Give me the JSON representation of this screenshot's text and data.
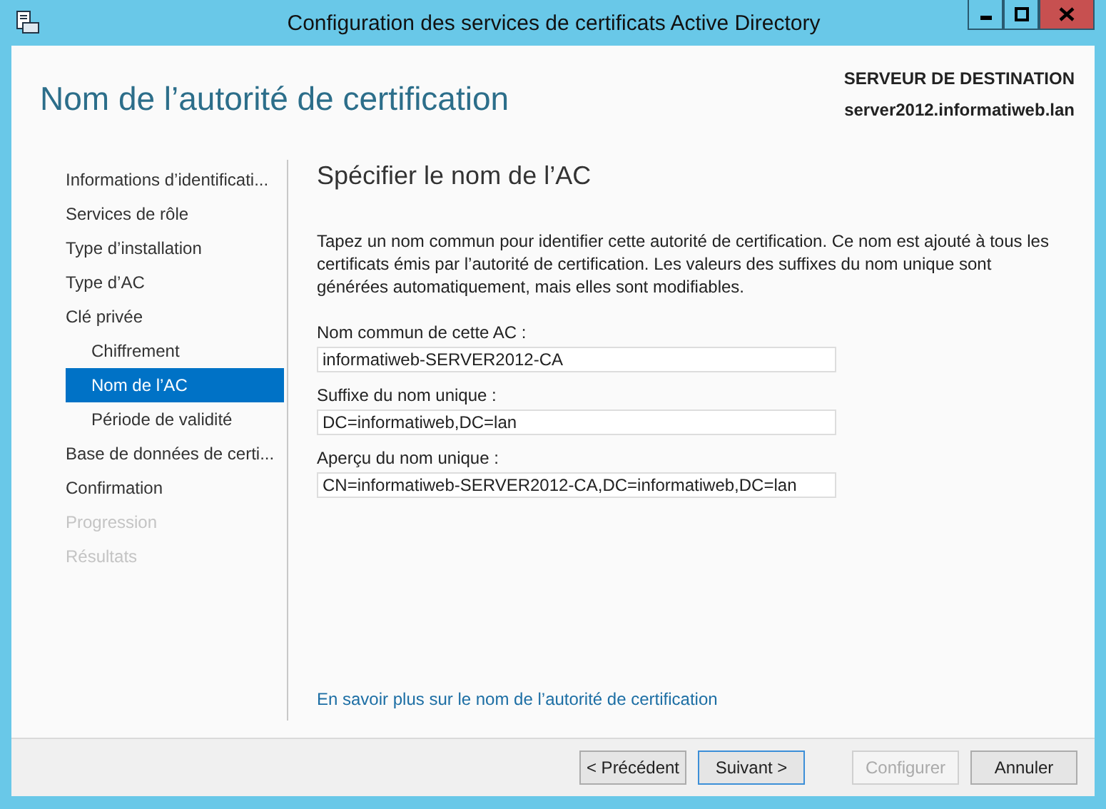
{
  "window": {
    "title": "Configuration des services de certificats Active Directory"
  },
  "header": {
    "title": "Nom de l’autorité de certification",
    "server_label": "SERVEUR DE DESTINATION",
    "server_name": "server2012.informatiweb.lan"
  },
  "sidebar": {
    "items": [
      {
        "label": "Informations d’identificati...",
        "selected": false,
        "disabled": false
      },
      {
        "label": "Services de rôle",
        "selected": false,
        "disabled": false
      },
      {
        "label": "Type d’installation",
        "selected": false,
        "disabled": false
      },
      {
        "label": "Type d’AC",
        "selected": false,
        "disabled": false
      },
      {
        "label": "Clé privée",
        "selected": false,
        "disabled": false,
        "children": [
          {
            "label": "Chiffrement",
            "selected": false,
            "disabled": false
          },
          {
            "label": "Nom de l’AC",
            "selected": true,
            "disabled": false
          },
          {
            "label": "Période de validité",
            "selected": false,
            "disabled": false
          }
        ]
      },
      {
        "label": "Base de données de certi...",
        "selected": false,
        "disabled": false
      },
      {
        "label": "Confirmation",
        "selected": false,
        "disabled": false
      },
      {
        "label": "Progression",
        "selected": false,
        "disabled": true
      },
      {
        "label": "Résultats",
        "selected": false,
        "disabled": true
      }
    ]
  },
  "content": {
    "heading": "Spécifier le nom de l’AC",
    "description": "Tapez un nom commun pour identifier cette autorité de certification. Ce nom est ajouté à tous les certificats émis par l’autorité de certification. Les valeurs des suffixes du nom unique sont générées automatiquement, mais elles sont modifiables.",
    "fields": [
      {
        "label": "Nom commun de cette AC :",
        "value": "informatiweb-SERVER2012-CA"
      },
      {
        "label": "Suffixe du nom unique :",
        "value": "DC=informatiweb,DC=lan"
      },
      {
        "label": "Aperçu du nom unique :",
        "value": "CN=informatiweb-SERVER2012-CA,DC=informatiweb,DC=lan"
      }
    ],
    "link": "En savoir plus sur le nom de l’autorité de certification"
  },
  "buttons": [
    {
      "label": "< Précédent",
      "focused": false,
      "disabled": false
    },
    {
      "label": "Suivant >",
      "focused": true,
      "disabled": false
    },
    {
      "label": "Configurer",
      "focused": false,
      "disabled": true
    },
    {
      "label": "Annuler",
      "focused": false,
      "disabled": false
    }
  ]
}
